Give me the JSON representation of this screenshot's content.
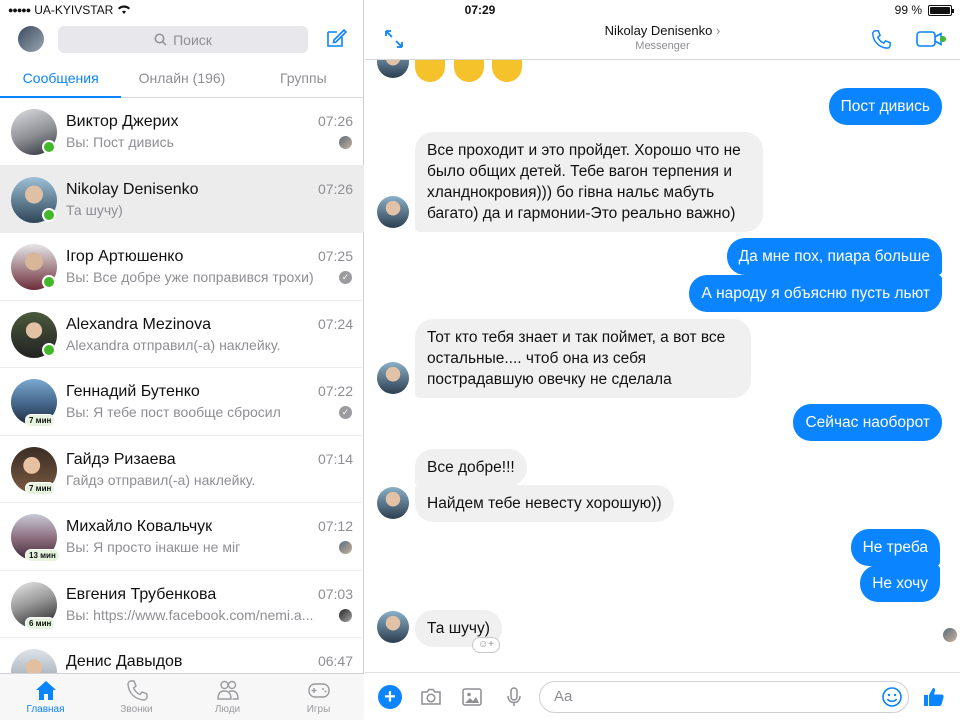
{
  "status": {
    "carrier": "UA-KYIVSTAR",
    "time": "07:29",
    "battery": "99 %",
    "battery_level": 0.99
  },
  "sidebar": {
    "search_placeholder": "Поиск",
    "tabs": [
      {
        "label": "Сообщения"
      },
      {
        "label": "Онлайн (196)"
      },
      {
        "label": "Группы"
      }
    ],
    "conversations": [
      {
        "name": "Виктор Джерих",
        "time": "07:26",
        "snippet": "Вы: Пост дивись"
      },
      {
        "name": "Nikolay Denisenko",
        "time": "07:26",
        "snippet": "Та шучу)"
      },
      {
        "name": "Ігор Артюшенко",
        "time": "07:25",
        "snippet": "Вы: Все добре уже поправився трохи)"
      },
      {
        "name": "Alexandra Mezinova",
        "time": "07:24",
        "snippet": "Alexandra отправил(-а) наклейку."
      },
      {
        "name": "Геннадий Бутенко",
        "time": "07:22",
        "snippet": "Вы: Я тебе пост вообще сбросил",
        "minutes": "7 мин"
      },
      {
        "name": "Гайдэ Ризаева",
        "time": "07:14",
        "snippet": "Гайдэ отправил(-а) наклейку.",
        "minutes": "7 мин"
      },
      {
        "name": "Михайло Ковальчук",
        "time": "07:12",
        "snippet": "Вы: Я просто інакше не міг",
        "minutes": "13 мин"
      },
      {
        "name": "Евгения Трубенкова",
        "time": "07:03",
        "snippet": "Вы: https://www.facebook.com/nemi.a...",
        "minutes": "6 мин"
      },
      {
        "name": "Денис Давыдов",
        "time": "06:47",
        "snippet": ""
      }
    ],
    "bottom_tabs": [
      {
        "label": "Главная"
      },
      {
        "label": "Звонки"
      },
      {
        "label": "Люди"
      },
      {
        "label": "Игры"
      }
    ]
  },
  "chat": {
    "contact_name": "Nikolay Denisenko",
    "contact_sub": "Messenger",
    "messages": [
      {
        "dir": "out",
        "text": "Пост дивись"
      },
      {
        "dir": "in",
        "text": "Все проходит и это пройдет. Хорошо что не было общих детей. Тебе вагон терпения и хланднокровия))) бо гівна нальє мабуть багато) да и гармонии-Это реально важно)"
      },
      {
        "dir": "out",
        "text": "Да мне пох, пиара больше"
      },
      {
        "dir": "out",
        "text": "А народу я объясню пусть льют"
      },
      {
        "dir": "in",
        "text": "Тот кто тебя знает и так поймет, а вот все остальные.... чтоб она из себя пострадавшую овечку не сделала"
      },
      {
        "dir": "out",
        "text": "Сейчас наоборот"
      },
      {
        "dir": "in",
        "text": "Все добре!!!"
      },
      {
        "dir": "in",
        "text": "Найдем тебе невесту хорошую))"
      },
      {
        "dir": "out",
        "text": "Не треба"
      },
      {
        "dir": "out",
        "text": "Не хочу"
      },
      {
        "dir": "in",
        "text": "Та шучу)"
      }
    ],
    "composer_placeholder": "Aa"
  },
  "colors": {
    "accent": "#0a84ff",
    "online": "#42b72a",
    "incoming_bubble": "#f1f0f0"
  }
}
